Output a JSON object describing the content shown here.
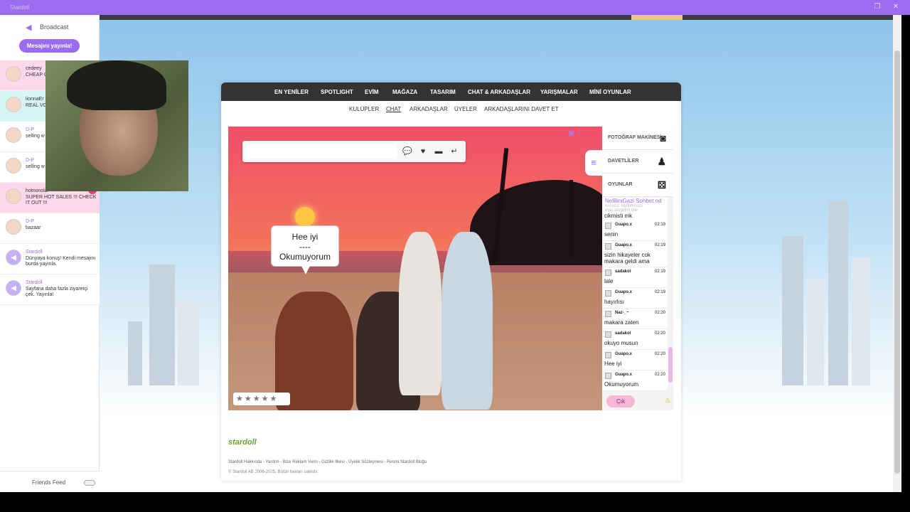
{
  "window": {
    "title": "Stardoll",
    "restore_icon": "❐",
    "close_icon": "✕"
  },
  "sidebar": {
    "broadcast_label": "Broadcast",
    "publish_button": "Mesajını yayınla!",
    "friends_feed_label": "Friends Feed",
    "feed": [
      {
        "name": "cedeey",
        "message": "CHEAP C CLOTHE",
        "bg": "pink"
      },
      {
        "name": "lionnaEr",
        "message": "REAL VC )",
        "bg": "teal"
      },
      {
        "name": "D-P",
        "message": "selling w",
        "bg": "plain"
      },
      {
        "name": "D-P",
        "message": "selling w",
        "bg": "plain"
      },
      {
        "name": "hotnonola",
        "message": "SUPER HOT SALES !!! CHECK IT OUT !!!",
        "bg": "pink"
      },
      {
        "name": "D-P",
        "message": "bazaar",
        "bg": "plain"
      },
      {
        "name": "Stardoll",
        "message": "Dünyaya konuş! Kendi mesajını burda yayınla.",
        "bg": "plain"
      },
      {
        "name": "Stardoll",
        "message": "Sayfana daha fazla ziyaretçi çek. Yayınla!",
        "bg": "plain"
      }
    ]
  },
  "nav": {
    "items": [
      "EN YENİLER",
      "SPOTLIGHT",
      "EVİM",
      "MAĞAZA",
      "TASARIM",
      "CHAT & ARKADAŞLAR",
      "YARIŞMALAR",
      "MİNİ OYUNLAR"
    ]
  },
  "subnav": {
    "items": [
      "KULÜPLER",
      "CHAT",
      "ARKADAŞLAR",
      "ÜYELER",
      "ARKADAŞLARINI DAVET ET"
    ],
    "active": "CHAT"
  },
  "scene": {
    "chat_input_value": "",
    "speech_lines": [
      "Hee iyi",
      "----",
      "Okumuyorum"
    ],
    "rating_stars": "★★★★★"
  },
  "side_panel": {
    "camera_label": "FOTOĞRAF MAKİNESİ",
    "invites_label": "DAVETLİLER",
    "games_label": "OYUNLAR",
    "room_name": "NefilimGazi Sohbet od",
    "room_sub": "Kurucu: NefilimGazi",
    "room_sub2": "eski sevgilimi bile",
    "first_line": "cikmisti mk",
    "messages": [
      {
        "user": "Guapo.x",
        "time": "02:19",
        "text": "senin"
      },
      {
        "user": "Guapo.x",
        "time": "02:19",
        "text": "sizin hikayeler cok makara geldi ama"
      },
      {
        "user": "sadakoi",
        "time": "02:19",
        "text": "lale"
      },
      {
        "user": "Guapo.x",
        "time": "02:19",
        "text": "hayırlısı"
      },
      {
        "user": "Naz-_~",
        "time": "02:20",
        "text": "makara zaten"
      },
      {
        "user": "sadakoi",
        "time": "02:20",
        "text": "okuyo musun"
      },
      {
        "user": "Guapo.x",
        "time": "02:20",
        "text": "Hee iyi"
      },
      {
        "user": "Guapo.x",
        "time": "02:20",
        "text": "Okumuyorum"
      }
    ],
    "exit_button": "Çık"
  },
  "footer": {
    "logo": "stardoll",
    "links": "Stardoll Hakkında - Yardım - Bize Reklam Verin - Gizlilik İlkesi - Üyelik Sözleşmesi - Resmi Stardoll Bloğu",
    "copyright": "© Stardoll AB 2006-2025. Bütün hakları saklıdır."
  },
  "colors": {
    "accent": "#9b6cf0",
    "pink_highlight": "#ffd9e9",
    "teal_highlight": "#d6f6f6",
    "nav_bg": "#333333"
  },
  "icons": [
    "broadcast-icon",
    "camera-icon",
    "invites-icon",
    "games-icon",
    "menu-icon",
    "send-icon",
    "warning-icon",
    "star-icon"
  ]
}
